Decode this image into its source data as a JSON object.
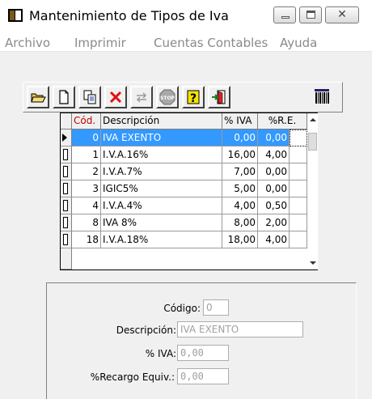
{
  "window": {
    "title": "Mantenimiento de Tipos de Iva"
  },
  "menu": [
    "Archivo",
    "Imprimir",
    "Cuentas Contables",
    "Ayuda"
  ],
  "toolbar": {
    "buttons": [
      "open-folder-icon",
      "new-document-icon",
      "copy-icon",
      "delete-x-icon",
      "swap-arrows-icon",
      "stop-icon",
      "help-icon",
      "exit-door-icon",
      "barcode-icon"
    ]
  },
  "grid": {
    "headers": {
      "code": "Cód.",
      "desc": "Descripción",
      "iva": "% IVA",
      "re": "%R.E."
    },
    "rows": [
      {
        "code": "0",
        "desc": "IVA EXENTO",
        "iva": "0,00",
        "re": "0,00"
      },
      {
        "code": "1",
        "desc": "I.V.A.16%",
        "iva": "16,00",
        "re": "4,00"
      },
      {
        "code": "2",
        "desc": "I.V.A.7%",
        "iva": "7,00",
        "re": "0,00"
      },
      {
        "code": "3",
        "desc": "IGIC5%",
        "iva": "5,00",
        "re": "0,00"
      },
      {
        "code": "4",
        "desc": "I.V.A.4%",
        "iva": "4,00",
        "re": "0,50"
      },
      {
        "code": "8",
        "desc": "IVA 8%",
        "iva": "8,00",
        "re": "2,00"
      },
      {
        "code": "18",
        "desc": "I.V.A.18%",
        "iva": "18,00",
        "re": "4,00"
      }
    ]
  },
  "detail": {
    "codigo_label": "Código:",
    "codigo_value": "0",
    "descripcion_label": "Descripción:",
    "descripcion_value": "IVA EXENTO",
    "iva_label": "% IVA:",
    "iva_value": "0,00",
    "recargo_label": "%Recargo Equiv.:",
    "recargo_value": "0,00"
  }
}
